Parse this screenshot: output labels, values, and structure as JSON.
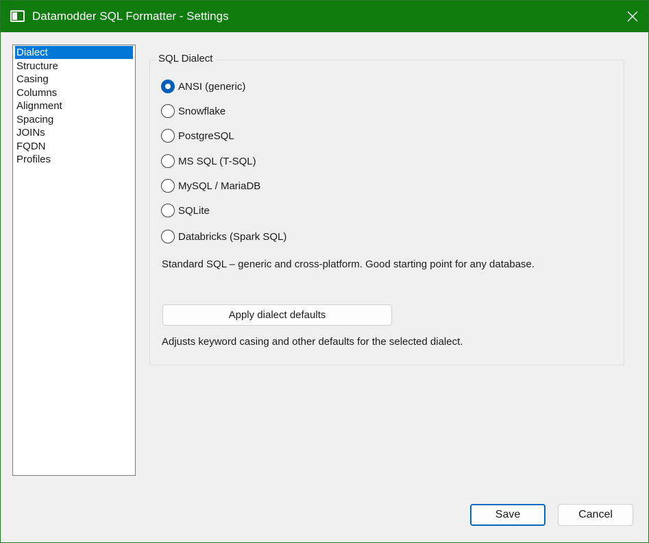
{
  "window": {
    "title": "Datamodder SQL Formatter - Settings",
    "accent_color": "#107c10"
  },
  "sidebar": {
    "items": [
      {
        "label": "Dialect",
        "selected": true
      },
      {
        "label": "Structure"
      },
      {
        "label": "Casing"
      },
      {
        "label": "Columns"
      },
      {
        "label": "Alignment"
      },
      {
        "label": "Spacing"
      },
      {
        "label": "JOINs"
      },
      {
        "label": "FQDN"
      },
      {
        "label": "Profiles"
      }
    ]
  },
  "dialect_group": {
    "title": "SQL Dialect",
    "options": [
      {
        "label": "ANSI  (generic)",
        "checked": true
      },
      {
        "label": "Snowflake"
      },
      {
        "label": "PostgreSQL"
      },
      {
        "label": "MS SQL  (T-SQL)"
      },
      {
        "label": "MySQL  /  MariaDB"
      },
      {
        "label": "SQLite"
      },
      {
        "label": "Databricks  (Spark SQL)"
      }
    ],
    "description": "Standard SQL – generic and cross-platform. Good starting point for any database.",
    "apply_button": "Apply dialect defaults",
    "apply_note": "Adjusts keyword casing and other defaults for the selected dialect."
  },
  "footer": {
    "save_label": "Save",
    "cancel_label": "Cancel"
  },
  "icons": {
    "app": "window-icon",
    "close": "close-icon"
  }
}
